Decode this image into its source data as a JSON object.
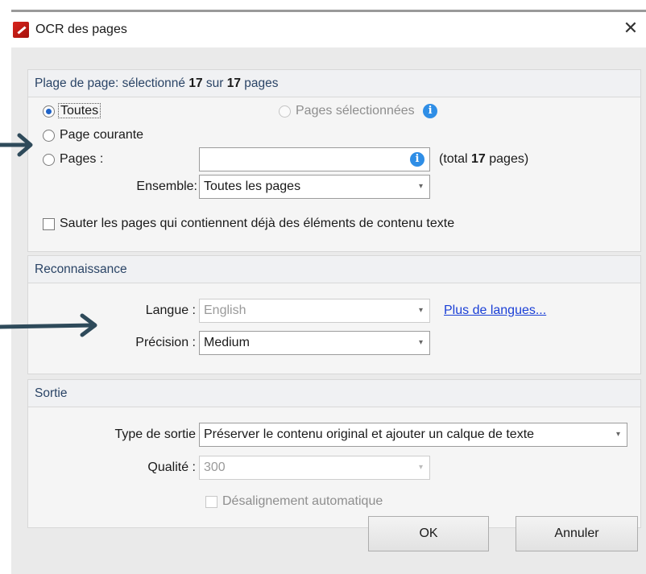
{
  "window": {
    "title": "OCR des pages",
    "close_glyph": "✕"
  },
  "page_range": {
    "header_prefix": "Plage de page: sélectionné ",
    "selected_count": "17",
    "header_mid": " sur ",
    "total_count": "17",
    "header_suffix": " pages",
    "all_label": "Toutes",
    "selected_pages_label": "Pages sélectionnées",
    "current_page_label": "Page courante",
    "pages_label": "Pages :",
    "pages_value": "",
    "total_prefix": "(total ",
    "total_bold": "17",
    "total_suffix": " pages)",
    "set_label": "Ensemble:",
    "set_value": "Toutes les pages",
    "skip_text_label": "Sauter les pages qui contiennent déjà des éléments de contenu texte",
    "selected": "Toutes"
  },
  "recognition": {
    "header": "Reconnaissance",
    "language_label": "Langue :",
    "language_value": "English",
    "more_languages_link": "Plus de langues...",
    "precision_label": "Précision :",
    "precision_value": "Medium"
  },
  "output": {
    "header": "Sortie",
    "type_label": "Type de sortie",
    "type_value": "Préserver le contenu original et ajouter un calque de texte",
    "quality_label": "Qualité :",
    "quality_value": "300",
    "deskew_label": "Désalignement automatique"
  },
  "buttons": {
    "ok": "OK",
    "cancel": "Annuler"
  },
  "icons": {
    "info": "i",
    "dropdown": "▾"
  },
  "colors": {
    "accent": "#1f63c8",
    "info": "#2f8ee6",
    "link": "#1a3fd6",
    "arrow": "#2e4a5a"
  }
}
